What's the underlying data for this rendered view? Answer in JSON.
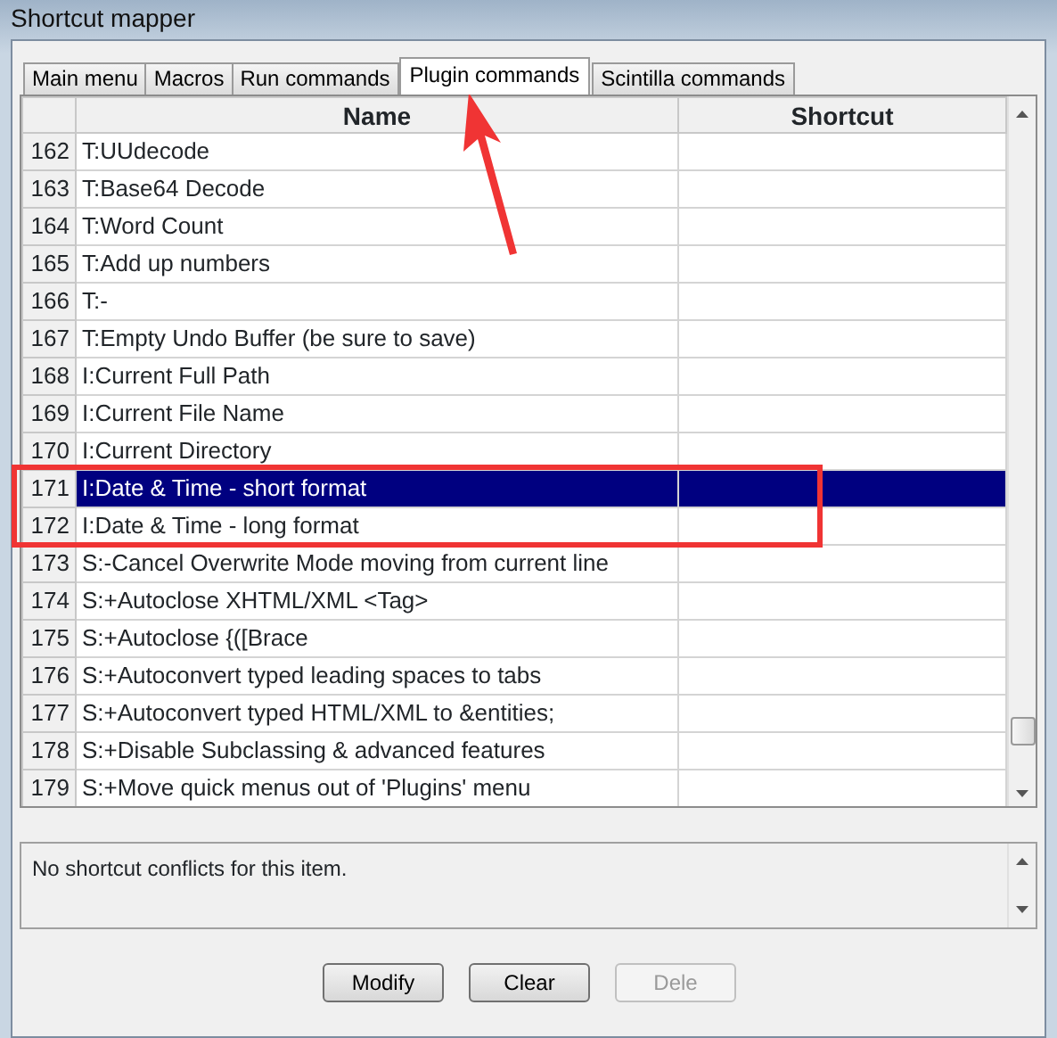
{
  "window": {
    "title": "Shortcut mapper"
  },
  "tabs": [
    {
      "label": "Main menu",
      "selected": false
    },
    {
      "label": "Macros",
      "selected": false
    },
    {
      "label": "Run commands",
      "selected": false
    },
    {
      "label": "Plugin commands",
      "selected": true
    },
    {
      "label": "Scintilla commands",
      "selected": false
    }
  ],
  "table": {
    "columns": [
      "Name",
      "Shortcut"
    ],
    "rows": [
      {
        "number": "162",
        "name": "T:UUdecode",
        "selected": false
      },
      {
        "number": "163",
        "name": "T:Base64 Decode",
        "selected": false
      },
      {
        "number": "164",
        "name": "T:Word Count",
        "selected": false
      },
      {
        "number": "165",
        "name": "T:Add up numbers",
        "selected": false
      },
      {
        "number": "166",
        "name": "T:-",
        "selected": false
      },
      {
        "number": "167",
        "name": "T:Empty Undo Buffer (be sure to save)",
        "selected": false
      },
      {
        "number": "168",
        "name": "I:Current Full Path",
        "selected": false
      },
      {
        "number": "169",
        "name": "I:Current File Name",
        "selected": false
      },
      {
        "number": "170",
        "name": "I:Current Directory",
        "selected": false
      },
      {
        "number": "171",
        "name": "I:Date & Time - short format",
        "selected": true
      },
      {
        "number": "172",
        "name": "I:Date & Time - long format",
        "selected": false
      },
      {
        "number": "173",
        "name": "S:-Cancel Overwrite Mode moving from current line",
        "selected": false
      },
      {
        "number": "174",
        "name": "S:+Autoclose XHTML/XML <Tag>",
        "selected": false
      },
      {
        "number": "175",
        "name": "S:+Autoclose {([Brace",
        "selected": false
      },
      {
        "number": "176",
        "name": "S:+Autoconvert typed leading spaces to tabs",
        "selected": false
      },
      {
        "number": "177",
        "name": "S:+Autoconvert typed HTML/XML to &entities;",
        "selected": false
      },
      {
        "number": "178",
        "name": "S:+Disable Subclassing & advanced features",
        "selected": false
      },
      {
        "number": "179",
        "name": "S:+Move quick menus out of 'Plugins' menu",
        "selected": false
      }
    ]
  },
  "conflicts": {
    "text": "No shortcut conflicts for this item."
  },
  "buttons": [
    {
      "label": "Modify",
      "disabled": false
    },
    {
      "label": "Clear",
      "disabled": false
    },
    {
      "label": "Dele",
      "disabled": true
    }
  ]
}
